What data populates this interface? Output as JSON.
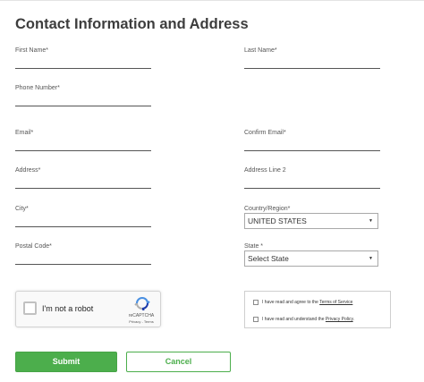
{
  "form": {
    "title": "Contact Information and Address",
    "fields": {
      "first_name": "First Name*",
      "last_name": "Last Name*",
      "phone": "Phone Number*",
      "email": "Email*",
      "confirm_email": "Confirm Email*",
      "address": "Address*",
      "address2": "Address Line 2",
      "city": "City*",
      "country": "Country/Region*",
      "postal": "Postal Code*",
      "state": "State *"
    },
    "country_value": "UNITED STATES",
    "state_value": "Select State"
  },
  "captcha": {
    "label": "I'm not a robot",
    "brand": "reCAPTCHA",
    "links": "Privacy - Terms"
  },
  "consent": {
    "terms_prefix": "I have read and agree to the ",
    "terms_link": "Terms of Service",
    "privacy_prefix": "I have read and understand the ",
    "privacy_link": "Privacy Policy",
    "period": "."
  },
  "buttons": {
    "submit": "Submit",
    "cancel": "Cancel"
  },
  "colors": {
    "accent": "#4cae4c"
  }
}
